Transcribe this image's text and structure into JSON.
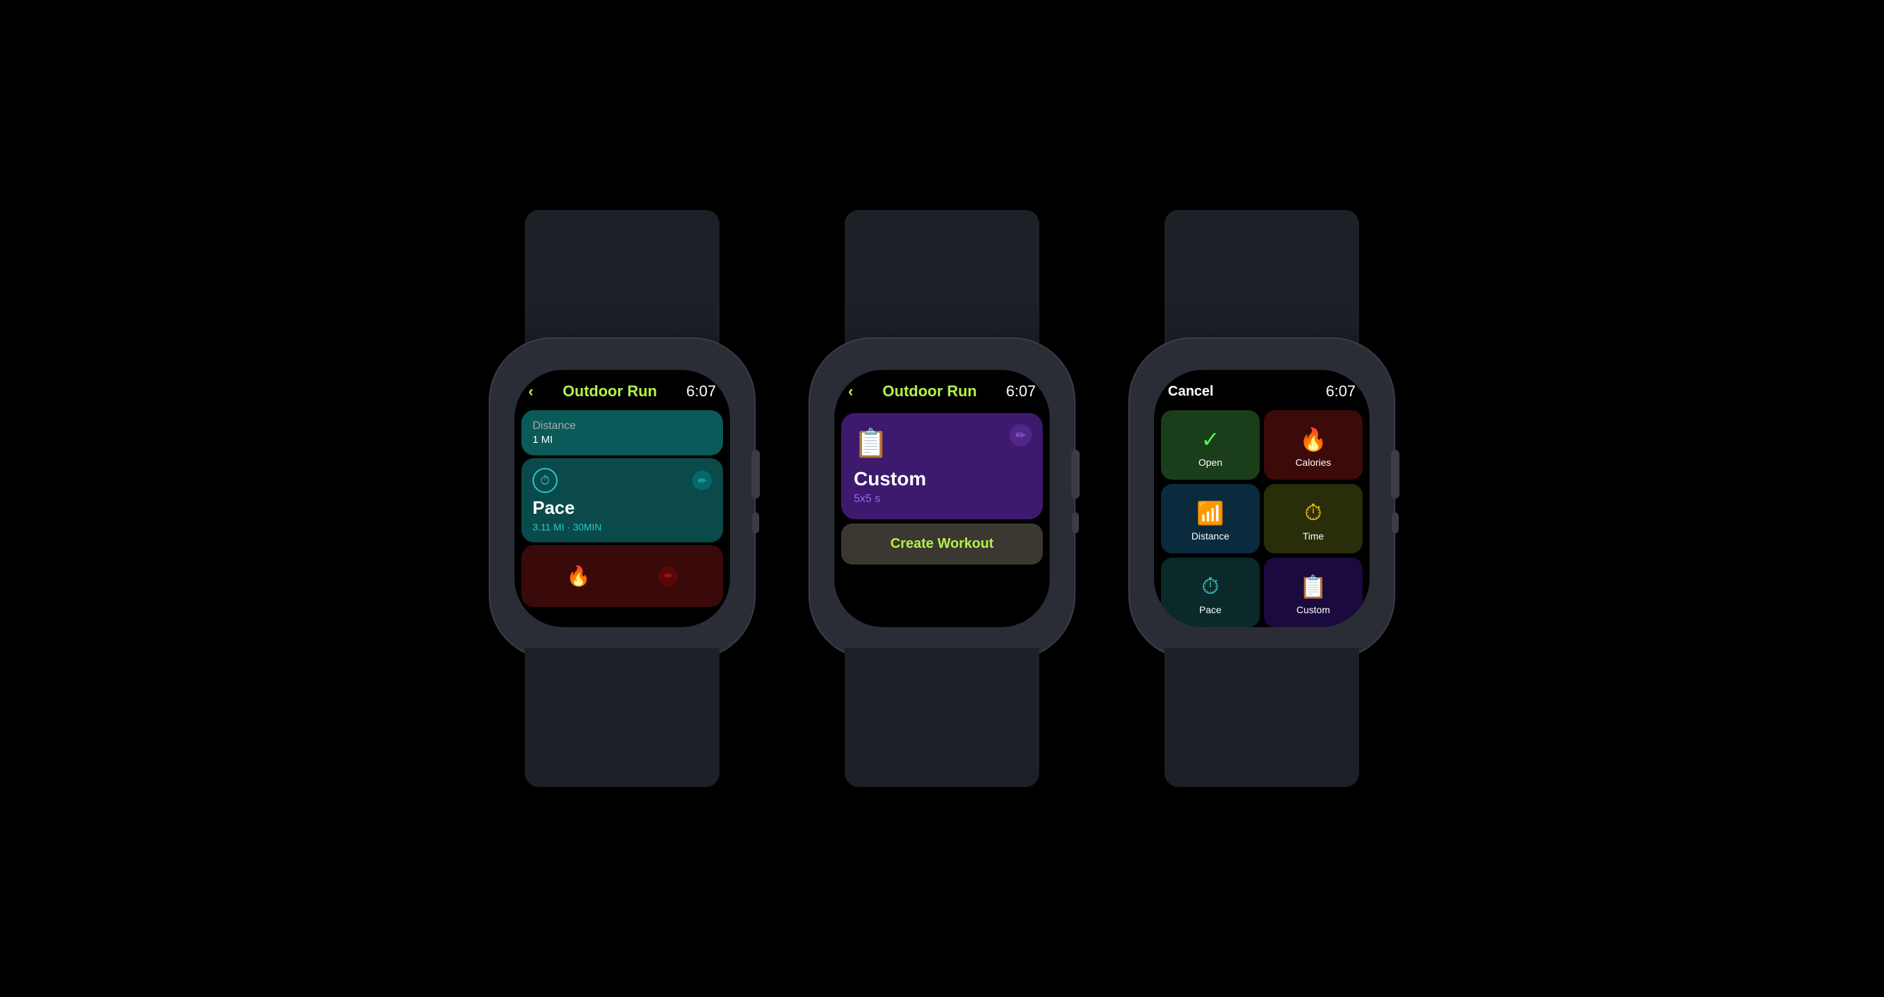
{
  "watches": [
    {
      "id": "watch1",
      "screen": {
        "header": {
          "back_label": "‹",
          "title": "Outdoor Run",
          "time": "6:07"
        },
        "cards": [
          {
            "type": "distance",
            "label": "Distance",
            "value": "1 MI",
            "bg": "distance"
          },
          {
            "type": "pace",
            "icon": "⏱",
            "title": "Pace",
            "subtitle": "3.11 MI · 30MIN",
            "bg": "pace"
          },
          {
            "type": "calories",
            "icon": "🔥",
            "bg": "calories"
          }
        ]
      }
    },
    {
      "id": "watch2",
      "screen": {
        "header": {
          "back_label": "‹",
          "title": "Outdoor Run",
          "time": "6:07"
        },
        "custom_card": {
          "title": "Custom",
          "subtitle": "5x5 s"
        },
        "create_button": "Create Workout"
      }
    },
    {
      "id": "watch3",
      "screen": {
        "header": {
          "cancel_label": "Cancel",
          "time": "6:07"
        },
        "grid": [
          {
            "icon": "✓",
            "label": "Open",
            "type": "open"
          },
          {
            "icon": "🔥",
            "label": "Calories",
            "type": "calories"
          },
          {
            "icon": "📊",
            "label": "Distance",
            "type": "distance"
          },
          {
            "icon": "⏱",
            "label": "Time",
            "type": "time"
          },
          {
            "icon": "⏱",
            "label": "Pace",
            "type": "pace"
          },
          {
            "icon": "📋",
            "label": "Custom",
            "type": "custom"
          }
        ]
      }
    }
  ]
}
